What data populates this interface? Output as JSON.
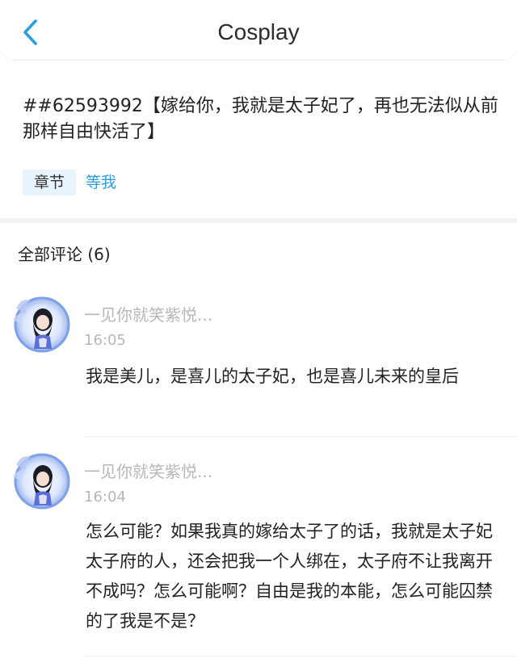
{
  "header": {
    "title": "Cosplay"
  },
  "post": {
    "text": "##62593992【嫁给你，我就是太子妃了，再也无法似从前那样自由快活了】",
    "tag_chip": "章节",
    "tag_link": "等我"
  },
  "comments_section": {
    "label": "全部评论 (6)"
  },
  "comments": [
    {
      "username": "一见你就笑紫悦...",
      "time": "16:05",
      "text": "我是美儿，是喜儿的太子妃，也是喜儿未来的皇后"
    },
    {
      "username": "一见你就笑紫悦...",
      "time": "16:04",
      "text": "怎么可能？如果我真的嫁给太子了的话，我就是太子妃太子府的人，还会把我一个人绑在，太子府不让我离开不成吗？怎么可能啊？自由是我的本能，怎么可能囚禁的了我是不是？"
    }
  ],
  "icons": {
    "back": "chevron-left-icon",
    "avatar": "anime-avatar"
  },
  "colors": {
    "accent": "#2a9fdc",
    "muted": "#b7b7b7",
    "chip_bg": "#e8f4fb"
  }
}
